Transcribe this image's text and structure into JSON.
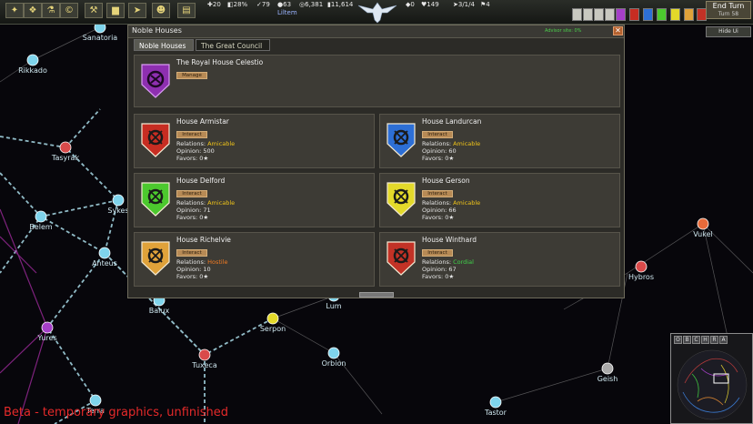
{
  "topbar": {
    "buttons": [
      {
        "name": "galaxy-button",
        "glyph": "✦"
      },
      {
        "name": "empire-button",
        "glyph": "❖"
      },
      {
        "name": "research-button",
        "glyph": "⚗"
      },
      {
        "name": "credits-button",
        "glyph": "©"
      },
      {
        "name": "production-button",
        "glyph": "⚒"
      },
      {
        "name": "planets-button",
        "glyph": "▆"
      },
      {
        "name": "fleet-button",
        "glyph": "➤"
      },
      {
        "name": "aliens-button",
        "glyph": "☻"
      },
      {
        "name": "messages-button",
        "glyph": "▤"
      }
    ],
    "resources": [
      "20",
      "28%",
      "79",
      "63",
      "6,381",
      "11,614"
    ],
    "subtext": "Liltem",
    "right_resources": [
      "0",
      "149",
      "3/1/4",
      "4"
    ],
    "end_turn_label": "End Turn",
    "turn_label": "Turn 58",
    "small_button": "Hide Ui"
  },
  "dialog": {
    "title": "Noble Houses",
    "advisor_text": "Advisor site: 0%",
    "close_glyph": "✕",
    "tabs": [
      "Noble Houses",
      "The Great Council"
    ],
    "royal_house": {
      "name": "The Royal House Celestio",
      "button": "Manage",
      "color": "#a53fc8"
    },
    "houses": [
      {
        "name": "House Armistar",
        "button": "Interact",
        "relations_label": "Relations: ",
        "relations": "Amicable",
        "relations_color": "#f0c419",
        "opinion": "Opinion: 500",
        "favors": "Favors: 0★",
        "color": "#c72d22"
      },
      {
        "name": "House Landurcan",
        "button": "Interact",
        "relations_label": "Relations: ",
        "relations": "Amicable",
        "relations_color": "#f0c419",
        "opinion": "Opinion: 60",
        "favors": "Favors: 0★",
        "color": "#2d6fd6"
      },
      {
        "name": "House Delford",
        "button": "Interact",
        "relations_label": "Relations: ",
        "relations": "Amicable",
        "relations_color": "#f0c419",
        "opinion": "Opinion: 71",
        "favors": "Favors: 0★",
        "color": "#4cc92e"
      },
      {
        "name": "House Gerson",
        "button": "Interact",
        "relations_label": "Relations: ",
        "relations": "Amicable",
        "relations_color": "#f0c419",
        "opinion": "Opinion: 66",
        "favors": "Favors: 0★",
        "color": "#e3d92a"
      },
      {
        "name": "House Richelvie",
        "button": "Interact",
        "relations_label": "Relations: ",
        "relations": "Hostile",
        "relations_color": "#f07a22",
        "opinion": "Opinion: 10",
        "favors": "Favors: 0★",
        "color": "#e0a23a"
      },
      {
        "name": "House Winthard",
        "button": "Interact",
        "relations_label": "Relations: ",
        "relations": "Cordial",
        "relations_color": "#3fd34a",
        "opinion": "Opinion: 67",
        "favors": "Favors: 0★",
        "color": "#c23226"
      }
    ]
  },
  "map": {
    "stars": [
      "Sanatoria",
      "Rikkado",
      "Tasyrak",
      "Sykes",
      "Belem",
      "Anteus",
      "Yures",
      "Balux",
      "Serpon",
      "Tuxeca",
      "Terra",
      "Orbion",
      "Vukel",
      "Hybros",
      "Geish",
      "Tastor",
      "Lum"
    ]
  },
  "minimap": {
    "tabs": [
      "O",
      "B",
      "C",
      "H",
      "R",
      "A"
    ]
  },
  "beta_text": "Beta - temporary graphics, unfinished"
}
